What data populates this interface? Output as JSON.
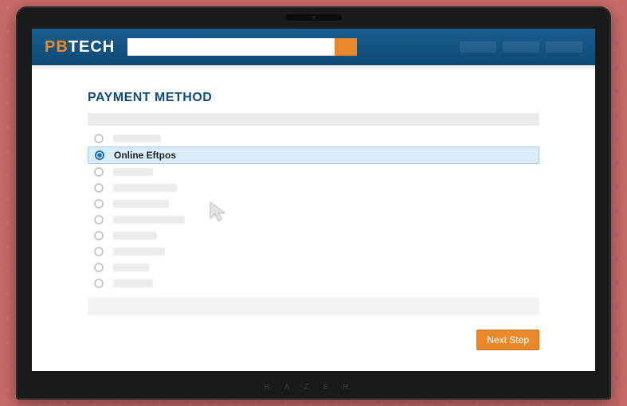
{
  "header": {
    "logo_pb": "PB",
    "logo_tech": "TECH",
    "search_value": "",
    "search_placeholder": ""
  },
  "page": {
    "section_title": "PAYMENT METHOD"
  },
  "payment": {
    "options": [
      {
        "label": "",
        "selected": false,
        "ghost_width": 60
      },
      {
        "label": "Online Eftpos",
        "selected": true
      },
      {
        "label": "",
        "selected": false,
        "ghost_width": 50
      },
      {
        "label": "",
        "selected": false,
        "ghost_width": 80
      },
      {
        "label": "",
        "selected": false,
        "ghost_width": 70
      },
      {
        "label": "",
        "selected": false,
        "ghost_width": 90
      },
      {
        "label": "",
        "selected": false,
        "ghost_width": 55
      },
      {
        "label": "",
        "selected": false,
        "ghost_width": 65
      },
      {
        "label": "",
        "selected": false,
        "ghost_width": 45
      },
      {
        "label": "",
        "selected": false,
        "ghost_width": 50
      }
    ]
  },
  "actions": {
    "next_label": "Next Step"
  },
  "device": {
    "brand_letters": "RAZER"
  }
}
